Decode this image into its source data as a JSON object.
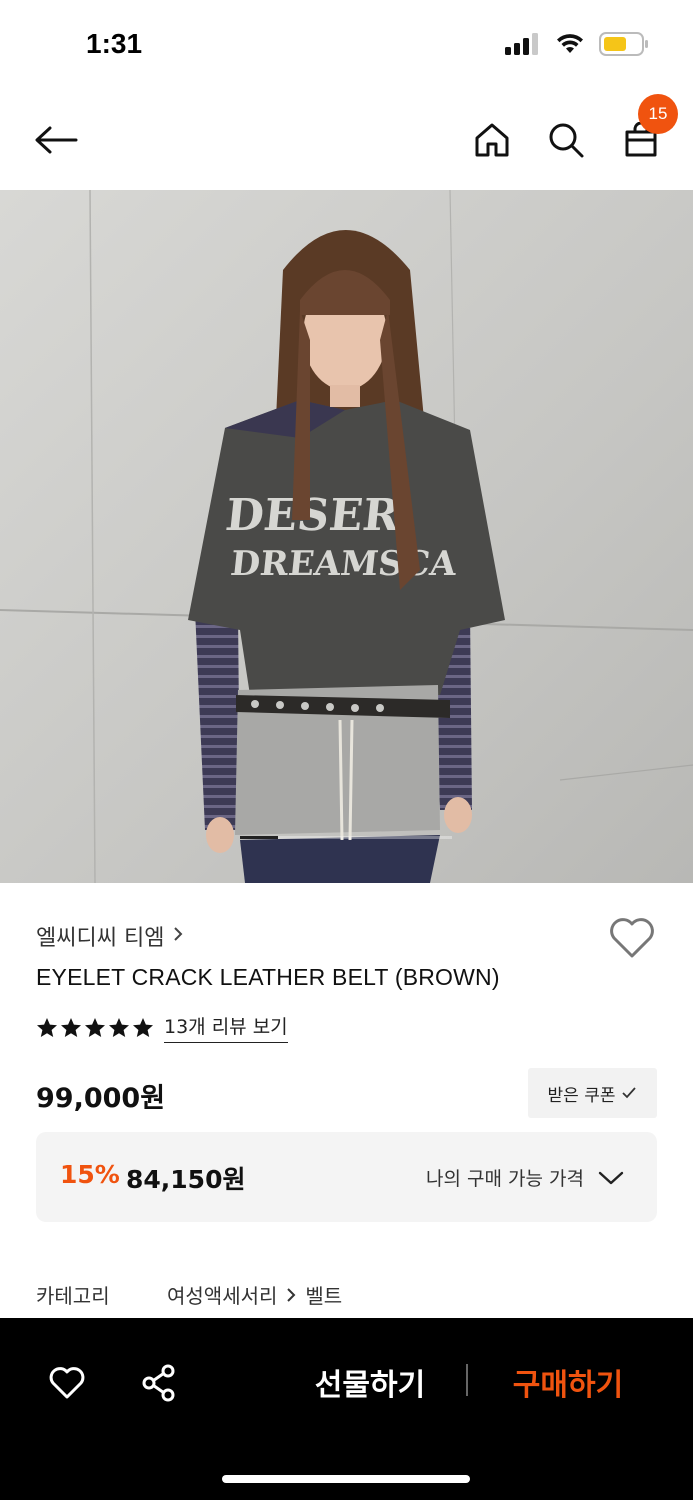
{
  "status_bar": {
    "time": "1:31"
  },
  "header": {
    "cart_count": "15"
  },
  "product": {
    "brand": "엘씨디씨 티엠",
    "title": "EYELET CRACK LEATHER BELT (BROWN)",
    "rating_stars": 5,
    "review_link": "13개 리뷰 보기",
    "price": "99,000원",
    "coupon_label": "받은 쿠폰",
    "discount_rate": "15%",
    "discount_price": "84,150원",
    "my_price_label": "나의 구매 가능 가격",
    "image_position": 0.18
  },
  "category": {
    "label": "카테고리",
    "path": [
      "여성액세서리",
      "벨트"
    ]
  },
  "bottom_bar": {
    "gift_label": "선물하기",
    "buy_label": "구매하기"
  },
  "colors": {
    "accent": "#f0530f"
  }
}
